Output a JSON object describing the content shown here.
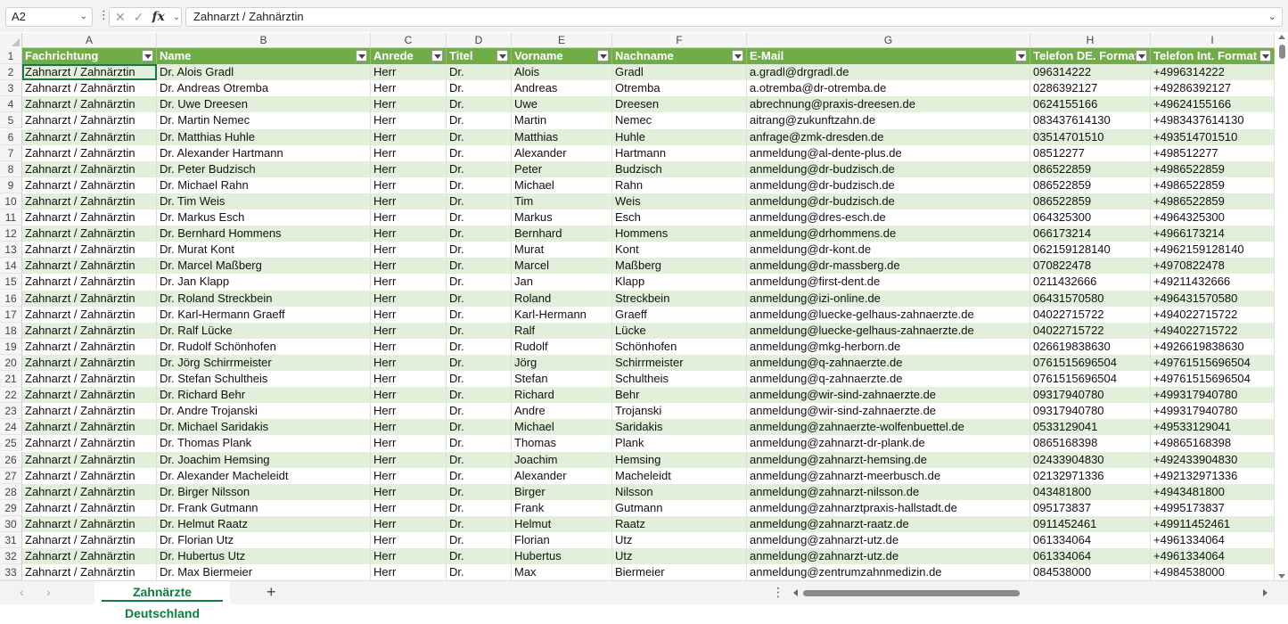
{
  "name_box": "A2",
  "formula": "Zahnarzt / Zahnärztin",
  "columns": [
    "A",
    "B",
    "C",
    "D",
    "E",
    "F",
    "G",
    "H",
    "I"
  ],
  "headers": [
    "Fachrichtung",
    "Name",
    "Anrede",
    "Titel",
    "Vorname",
    "Nachname",
    "E-Mail",
    "Telefon DE. Format",
    "Telefon Int. Format"
  ],
  "rows": [
    [
      "Zahnarzt / Zahnärztin",
      "Dr. Alois Gradl",
      "Herr",
      "Dr.",
      "Alois",
      "Gradl",
      "a.gradl@drgradl.de",
      "096314222",
      "+4996314222"
    ],
    [
      "Zahnarzt / Zahnärztin",
      "Dr. Andreas Otremba",
      "Herr",
      "Dr.",
      "Andreas",
      "Otremba",
      "a.otremba@dr-otremba.de",
      "0286392127",
      "+49286392127"
    ],
    [
      "Zahnarzt / Zahnärztin",
      "Dr. Uwe Dreesen",
      "Herr",
      "Dr.",
      "Uwe",
      "Dreesen",
      "abrechnung@praxis-dreesen.de",
      "0624155166",
      "+49624155166"
    ],
    [
      "Zahnarzt / Zahnärztin",
      "Dr. Martin Nemec",
      "Herr",
      "Dr.",
      "Martin",
      "Nemec",
      "aitrang@zukunftzahn.de",
      "083437614130",
      "+4983437614130"
    ],
    [
      "Zahnarzt / Zahnärztin",
      "Dr. Matthias Huhle",
      "Herr",
      "Dr.",
      "Matthias",
      "Huhle",
      "anfrage@zmk-dresden.de",
      "03514701510",
      "+493514701510"
    ],
    [
      "Zahnarzt / Zahnärztin",
      "Dr. Alexander Hartmann",
      "Herr",
      "Dr.",
      "Alexander",
      "Hartmann",
      "anmeldung@al-dente-plus.de",
      "08512277",
      "+498512277"
    ],
    [
      "Zahnarzt / Zahnärztin",
      "Dr. Peter Budzisch",
      "Herr",
      "Dr.",
      "Peter",
      "Budzisch",
      "anmeldung@dr-budzisch.de",
      "086522859",
      "+4986522859"
    ],
    [
      "Zahnarzt / Zahnärztin",
      "Dr. Michael Rahn",
      "Herr",
      "Dr.",
      "Michael",
      "Rahn",
      "anmeldung@dr-budzisch.de",
      "086522859",
      "+4986522859"
    ],
    [
      "Zahnarzt / Zahnärztin",
      "Dr. Tim Weis",
      "Herr",
      "Dr.",
      "Tim",
      "Weis",
      "anmeldung@dr-budzisch.de",
      "086522859",
      "+4986522859"
    ],
    [
      "Zahnarzt / Zahnärztin",
      "Dr. Markus Esch",
      "Herr",
      "Dr.",
      "Markus",
      "Esch",
      "anmeldung@dres-esch.de",
      "064325300",
      "+4964325300"
    ],
    [
      "Zahnarzt / Zahnärztin",
      "Dr. Bernhard Hommens",
      "Herr",
      "Dr.",
      "Bernhard",
      "Hommens",
      "anmeldung@drhommens.de",
      "066173214",
      "+4966173214"
    ],
    [
      "Zahnarzt / Zahnärztin",
      "Dr. Murat Kont",
      "Herr",
      "Dr.",
      "Murat",
      "Kont",
      "anmeldung@dr-kont.de",
      "062159128140",
      "+4962159128140"
    ],
    [
      "Zahnarzt / Zahnärztin",
      "Dr. Marcel Maßberg",
      "Herr",
      "Dr.",
      "Marcel",
      "Maßberg",
      "anmeldung@dr-massberg.de",
      "070822478",
      "+4970822478"
    ],
    [
      "Zahnarzt / Zahnärztin",
      "Dr. Jan Klapp",
      "Herr",
      "Dr.",
      "Jan",
      "Klapp",
      "anmeldung@first-dent.de",
      "0211432666",
      "+49211432666"
    ],
    [
      "Zahnarzt / Zahnärztin",
      "Dr. Roland Streckbein",
      "Herr",
      "Dr.",
      "Roland",
      "Streckbein",
      "anmeldung@izi-online.de",
      "06431570580",
      "+496431570580"
    ],
    [
      "Zahnarzt / Zahnärztin",
      "Dr. Karl-Hermann Graeff",
      "Herr",
      "Dr.",
      "Karl-Hermann",
      "Graeff",
      "anmeldung@luecke-gelhaus-zahnaerzte.de",
      "04022715722",
      "+494022715722"
    ],
    [
      "Zahnarzt / Zahnärztin",
      "Dr. Ralf Lücke",
      "Herr",
      "Dr.",
      "Ralf",
      "Lücke",
      "anmeldung@luecke-gelhaus-zahnaerzte.de",
      "04022715722",
      "+494022715722"
    ],
    [
      "Zahnarzt / Zahnärztin",
      "Dr. Rudolf Schönhofen",
      "Herr",
      "Dr.",
      "Rudolf",
      "Schönhofen",
      "anmeldung@mkg-herborn.de",
      "026619838630",
      "+4926619838630"
    ],
    [
      "Zahnarzt / Zahnärztin",
      "Dr. Jörg Schirrmeister",
      "Herr",
      "Dr.",
      "Jörg",
      "Schirrmeister",
      "anmeldung@q-zahnaerzte.de",
      "0761515696504",
      "+49761515696504"
    ],
    [
      "Zahnarzt / Zahnärztin",
      "Dr. Stefan Schultheis",
      "Herr",
      "Dr.",
      "Stefan",
      "Schultheis",
      "anmeldung@q-zahnaerzte.de",
      "0761515696504",
      "+49761515696504"
    ],
    [
      "Zahnarzt / Zahnärztin",
      "Dr. Richard Behr",
      "Herr",
      "Dr.",
      "Richard",
      "Behr",
      "anmeldung@wir-sind-zahnaerzte.de",
      "09317940780",
      "+499317940780"
    ],
    [
      "Zahnarzt / Zahnärztin",
      "Dr. Andre Trojanski",
      "Herr",
      "Dr.",
      "Andre",
      "Trojanski",
      "anmeldung@wir-sind-zahnaerzte.de",
      "09317940780",
      "+499317940780"
    ],
    [
      "Zahnarzt / Zahnärztin",
      "Dr. Michael Saridakis",
      "Herr",
      "Dr.",
      "Michael",
      "Saridakis",
      "anmeldung@zahnaerzte-wolfenbuettel.de",
      "0533129041",
      "+49533129041"
    ],
    [
      "Zahnarzt / Zahnärztin",
      "Dr. Thomas Plank",
      "Herr",
      "Dr.",
      "Thomas",
      "Plank",
      "anmeldung@zahnarzt-dr-plank.de",
      "0865168398",
      "+49865168398"
    ],
    [
      "Zahnarzt / Zahnärztin",
      "Dr. Joachim Hemsing",
      "Herr",
      "Dr.",
      "Joachim",
      "Hemsing",
      "anmeldung@zahnarzt-hemsing.de",
      "02433904830",
      "+492433904830"
    ],
    [
      "Zahnarzt / Zahnärztin",
      "Dr. Alexander Macheleidt",
      "Herr",
      "Dr.",
      "Alexander",
      "Macheleidt",
      "anmeldung@zahnarzt-meerbusch.de",
      "02132971336",
      "+492132971336"
    ],
    [
      "Zahnarzt / Zahnärztin",
      "Dr. Birger Nilsson",
      "Herr",
      "Dr.",
      "Birger",
      "Nilsson",
      "anmeldung@zahnarzt-nilsson.de",
      "043481800",
      "+4943481800"
    ],
    [
      "Zahnarzt / Zahnärztin",
      "Dr. Frank Gutmann",
      "Herr",
      "Dr.",
      "Frank",
      "Gutmann",
      "anmeldung@zahnarztpraxis-hallstadt.de",
      "095173837",
      "+4995173837"
    ],
    [
      "Zahnarzt / Zahnärztin",
      "Dr. Helmut Raatz",
      "Herr",
      "Dr.",
      "Helmut",
      "Raatz",
      "anmeldung@zahnarzt-raatz.de",
      "0911452461",
      "+49911452461"
    ],
    [
      "Zahnarzt / Zahnärztin",
      "Dr. Florian Utz",
      "Herr",
      "Dr.",
      "Florian",
      "Utz",
      "anmeldung@zahnarzt-utz.de",
      "061334064",
      "+4961334064"
    ],
    [
      "Zahnarzt / Zahnärztin",
      "Dr. Hubertus Utz",
      "Herr",
      "Dr.",
      "Hubertus",
      "Utz",
      "anmeldung@zahnarzt-utz.de",
      "061334064",
      "+4961334064"
    ],
    [
      "Zahnarzt / Zahnärztin",
      "Dr. Max Biermeier",
      "Herr",
      "Dr.",
      "Max",
      "Biermeier",
      "anmeldung@zentrumzahnmedizin.de",
      "084538000",
      "+4984538000"
    ]
  ],
  "sheet_tab": "Zahnärzte Deutschland",
  "add_sheet_symbol": "+",
  "colors": {
    "header_green": "#70ad47",
    "band_green": "#e2efda",
    "accent": "#107c41"
  }
}
